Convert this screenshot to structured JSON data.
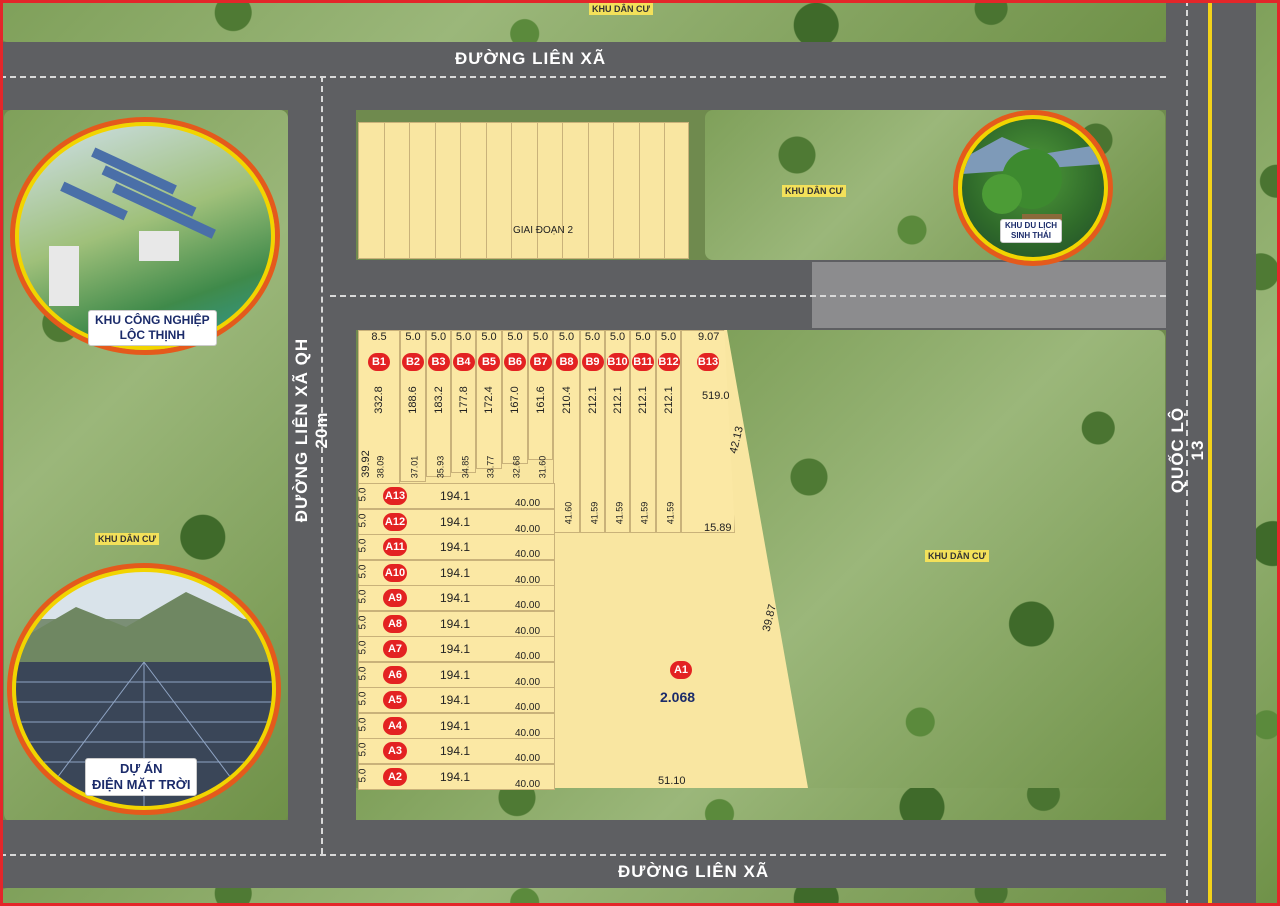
{
  "roads": {
    "top": "ĐƯỜNG LIÊN XÃ",
    "bottom": "ĐƯỜNG LIÊN XÃ",
    "left": "ĐƯỜNG LIÊN XÃ QH 20m",
    "right": "QUỐC LỘ 13"
  },
  "areas": {
    "khu_dan_cu": "KHU DÂN CƯ",
    "giai_doan_2": "GIAI ĐOẠN 2"
  },
  "callouts": {
    "industrial": [
      "KHU CÔNG NGHIỆP",
      "LỘC THỊNH"
    ],
    "solar": [
      "DỰ ÁN",
      "ĐIỆN MẶT TRỜI"
    ],
    "eco": [
      "KHU DU LỊCH",
      "SINH THÁI"
    ]
  },
  "b_lots": [
    {
      "id": "B1",
      "width": "8.5",
      "area": "332.8",
      "depth": "38.09"
    },
    {
      "id": "B2",
      "width": "5.0",
      "area": "188.6",
      "depth": "37.01"
    },
    {
      "id": "B3",
      "width": "5.0",
      "area": "183.2",
      "depth": "35.93"
    },
    {
      "id": "B4",
      "width": "5.0",
      "area": "177.8",
      "depth": "34.85"
    },
    {
      "id": "B5",
      "width": "5.0",
      "area": "172.4",
      "depth": "33.77"
    },
    {
      "id": "B6",
      "width": "5.0",
      "area": "167.0",
      "depth": "32.68"
    },
    {
      "id": "B7",
      "width": "5.0",
      "area": "161.6",
      "depth": "31.60"
    },
    {
      "id": "B8",
      "width": "5.0",
      "area": "210.4",
      "depth": "41.60"
    },
    {
      "id": "B9",
      "width": "5.0",
      "area": "212.1",
      "depth": "41.59"
    },
    {
      "id": "B10",
      "width": "5.0",
      "area": "212.1",
      "depth": "41.59"
    },
    {
      "id": "B11",
      "width": "5.0",
      "area": "212.1",
      "depth": "41.59"
    },
    {
      "id": "B12",
      "width": "5.0",
      "area": "212.1",
      "depth": "41.59"
    },
    {
      "id": "B13",
      "width": "9.07",
      "area": "519.0",
      "depth": ""
    }
  ],
  "b_extra": {
    "left_edge": "39.92",
    "b13_side": "42.13",
    "b13_bottom": "15.89"
  },
  "a_lots": [
    {
      "id": "A13",
      "width": "5.0",
      "area": "194.1",
      "depth": "40.00"
    },
    {
      "id": "A12",
      "width": "5.0",
      "area": "194.1",
      "depth": "40.00"
    },
    {
      "id": "A11",
      "width": "5.0",
      "area": "194.1",
      "depth": "40.00"
    },
    {
      "id": "A10",
      "width": "5.0",
      "area": "194.1",
      "depth": "40.00"
    },
    {
      "id": "A9",
      "width": "5.0",
      "area": "194.1",
      "depth": "40.00"
    },
    {
      "id": "A8",
      "width": "5.0",
      "area": "194.1",
      "depth": "40.00"
    },
    {
      "id": "A7",
      "width": "5.0",
      "area": "194.1",
      "depth": "40.00"
    },
    {
      "id": "A6",
      "width": "5.0",
      "area": "194.1",
      "depth": "40.00"
    },
    {
      "id": "A5",
      "width": "5.0",
      "area": "194.1",
      "depth": "40.00"
    },
    {
      "id": "A4",
      "width": "5.0",
      "area": "194.1",
      "depth": "40.00"
    },
    {
      "id": "A3",
      "width": "5.0",
      "area": "194.1",
      "depth": "40.00"
    },
    {
      "id": "A2",
      "width": "5.0",
      "area": "194.1",
      "depth": "40.00"
    }
  ],
  "a1": {
    "id": "A1",
    "area": "2.068",
    "side": "39.87",
    "bottom": "51.10"
  },
  "colors": {
    "road": "#5e5f62",
    "lot": "#fbe8a4",
    "badge": "#e32222",
    "frame": "#e3262a"
  }
}
